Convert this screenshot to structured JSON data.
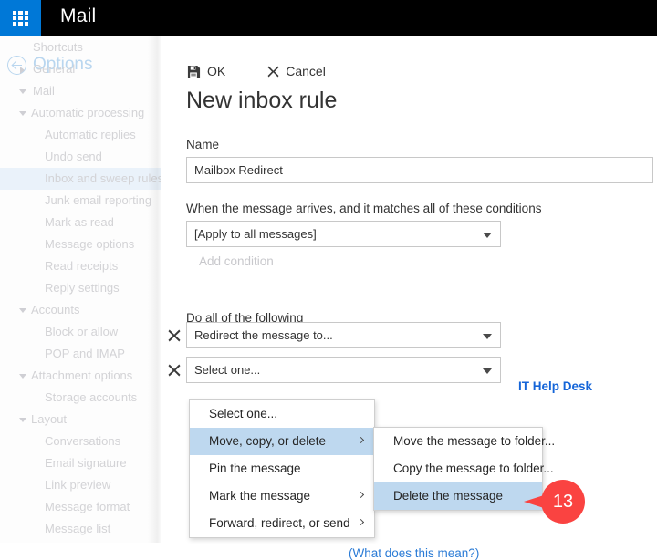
{
  "topbar": {
    "app_launcher_icon": "waffle-grid-icon",
    "app_title": "Mail",
    "accent_color": "#0078d7",
    "background_color": "#000000"
  },
  "sidebar": {
    "back_icon": "back-circle-arrow-icon",
    "header": "Options",
    "items": [
      {
        "label": "Shortcuts",
        "level": 0,
        "expander": "none",
        "selected": false
      },
      {
        "label": "General",
        "level": 0,
        "expander": "collapsed",
        "selected": false
      },
      {
        "label": "Mail",
        "level": 0,
        "expander": "expanded",
        "selected": false
      },
      {
        "label": "Automatic processing",
        "level": 1,
        "expander": "expanded",
        "selected": false
      },
      {
        "label": "Automatic replies",
        "level": 2,
        "expander": "none",
        "selected": false
      },
      {
        "label": "Undo send",
        "level": 2,
        "expander": "none",
        "selected": false
      },
      {
        "label": "Inbox and sweep rules",
        "level": 2,
        "expander": "none",
        "selected": true
      },
      {
        "label": "Junk email reporting",
        "level": 2,
        "expander": "none",
        "selected": false
      },
      {
        "label": "Mark as read",
        "level": 2,
        "expander": "none",
        "selected": false
      },
      {
        "label": "Message options",
        "level": 2,
        "expander": "none",
        "selected": false
      },
      {
        "label": "Read receipts",
        "level": 2,
        "expander": "none",
        "selected": false
      },
      {
        "label": "Reply settings",
        "level": 2,
        "expander": "none",
        "selected": false
      },
      {
        "label": "Accounts",
        "level": 1,
        "expander": "expanded",
        "selected": false
      },
      {
        "label": "Block or allow",
        "level": 2,
        "expander": "none",
        "selected": false
      },
      {
        "label": "POP and IMAP",
        "level": 2,
        "expander": "none",
        "selected": false
      },
      {
        "label": "Attachment options",
        "level": 1,
        "expander": "expanded",
        "selected": false
      },
      {
        "label": "Storage accounts",
        "level": 2,
        "expander": "none",
        "selected": false
      },
      {
        "label": "Layout",
        "level": 1,
        "expander": "expanded",
        "selected": false
      },
      {
        "label": "Conversations",
        "level": 2,
        "expander": "none",
        "selected": false
      },
      {
        "label": "Email signature",
        "level": 2,
        "expander": "none",
        "selected": false
      },
      {
        "label": "Link preview",
        "level": 2,
        "expander": "none",
        "selected": false
      },
      {
        "label": "Message format",
        "level": 2,
        "expander": "none",
        "selected": false
      },
      {
        "label": "Message list",
        "level": 2,
        "expander": "none",
        "selected": false
      }
    ],
    "selected_highlight_color": "#eaf2fa"
  },
  "toolbar": {
    "ok_label": "OK",
    "ok_icon": "save-floppy-icon",
    "cancel_label": "Cancel",
    "cancel_icon": "close-x-icon"
  },
  "form": {
    "page_title": "New inbox rule",
    "name_label": "Name",
    "name_value": "Mailbox Redirect",
    "name_placeholder": "",
    "condition_label": "When the message arrives, and it matches all of these conditions",
    "condition_value": "[Apply to all messages]",
    "add_condition_label": "Add condition",
    "actions_label": "Do all of the following",
    "action_1_value": "Redirect the message to...",
    "action_1_target": "IT Help Desk",
    "action_1_target_color": "#1565d8",
    "action_2_value": "Select one...",
    "remove_icon": "close-x-icon",
    "more_info_link": "(What does this mean?)"
  },
  "menu_primary": {
    "items": [
      {
        "label": "Select one...",
        "submenu": false,
        "highlighted": false
      },
      {
        "label": "Move, copy, or delete",
        "submenu": true,
        "highlighted": true
      },
      {
        "label": "Pin the message",
        "submenu": false,
        "highlighted": false
      },
      {
        "label": "Mark the message",
        "submenu": true,
        "highlighted": false
      },
      {
        "label": "Forward, redirect, or send",
        "submenu": true,
        "highlighted": false
      }
    ],
    "highlight_color": "#bed8ef"
  },
  "menu_submenu": {
    "items": [
      {
        "label": "Move the message to folder...",
        "highlighted": false
      },
      {
        "label": "Copy the message to folder...",
        "highlighted": false
      },
      {
        "label": "Delete the message",
        "highlighted": true
      }
    ]
  },
  "callout": {
    "number": "13",
    "color": "#fa4341"
  }
}
